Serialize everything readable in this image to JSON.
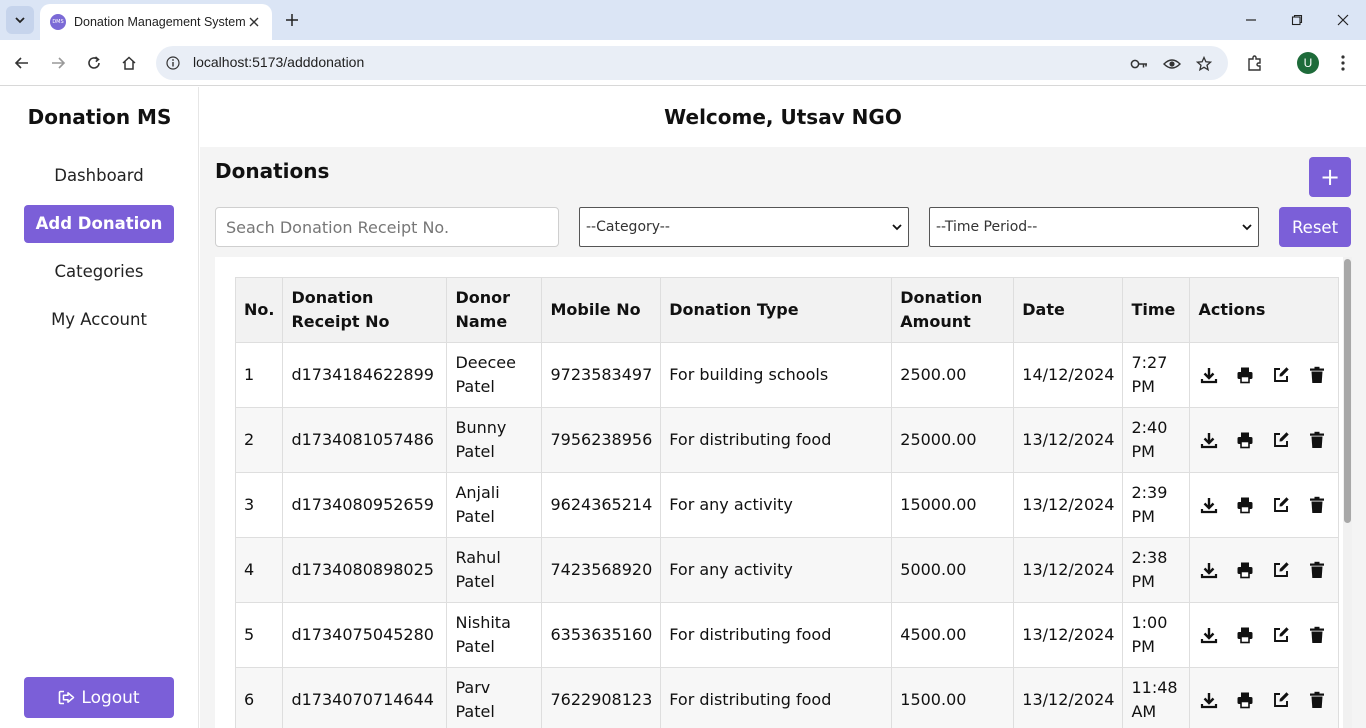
{
  "browser": {
    "tab_title": "Donation Management System",
    "favicon_text": "DMS",
    "url": "localhost:5173/adddonation",
    "profile_initial": "U"
  },
  "sidebar": {
    "brand": "Donation MS",
    "items": [
      {
        "label": "Dashboard",
        "active": false
      },
      {
        "label": "Add Donation",
        "active": true
      },
      {
        "label": "Categories",
        "active": false
      },
      {
        "label": "My Account",
        "active": false
      }
    ],
    "logout_label": "Logout"
  },
  "header": {
    "welcome": "Welcome, Utsav NGO"
  },
  "main": {
    "title": "Donations",
    "add_label": "+",
    "search_placeholder": "Seach Donation Receipt No.",
    "category_select": "--Category--",
    "time_select": "--Time Period--",
    "reset_label": "Reset"
  },
  "table": {
    "headers": [
      "No.",
      "Donation Receipt No",
      "Donor Name",
      "Mobile No",
      "Donation Type",
      "Donation Amount",
      "Date",
      "Time",
      "Actions"
    ],
    "rows": [
      {
        "no": "1",
        "receipt": "d1734184622899",
        "donor": "Deecee Patel",
        "mobile": "9723583497",
        "type": "For building schools",
        "amount": "2500.00",
        "date": "14/12/2024",
        "time": "7:27 PM"
      },
      {
        "no": "2",
        "receipt": "d1734081057486",
        "donor": "Bunny Patel",
        "mobile": "7956238956",
        "type": "For distributing food",
        "amount": "25000.00",
        "date": "13/12/2024",
        "time": "2:40 PM"
      },
      {
        "no": "3",
        "receipt": "d1734080952659",
        "donor": "Anjali Patel",
        "mobile": "9624365214",
        "type": "For any activity",
        "amount": "15000.00",
        "date": "13/12/2024",
        "time": "2:39 PM"
      },
      {
        "no": "4",
        "receipt": "d1734080898025",
        "donor": "Rahul Patel",
        "mobile": "7423568920",
        "type": "For any activity",
        "amount": "5000.00",
        "date": "13/12/2024",
        "time": "2:38 PM"
      },
      {
        "no": "5",
        "receipt": "d1734075045280",
        "donor": "Nishita Patel",
        "mobile": "6353635160",
        "type": "For distributing food",
        "amount": "4500.00",
        "date": "13/12/2024",
        "time": "1:00 PM"
      },
      {
        "no": "6",
        "receipt": "d1734070714644",
        "donor": "Parv Patel",
        "mobile": "7622908123",
        "type": "For distributing food",
        "amount": "1500.00",
        "date": "13/12/2024",
        "time": "11:48 AM"
      }
    ]
  },
  "colors": {
    "accent": "#7b5fd8",
    "tabbar": "#dbe5f5"
  }
}
